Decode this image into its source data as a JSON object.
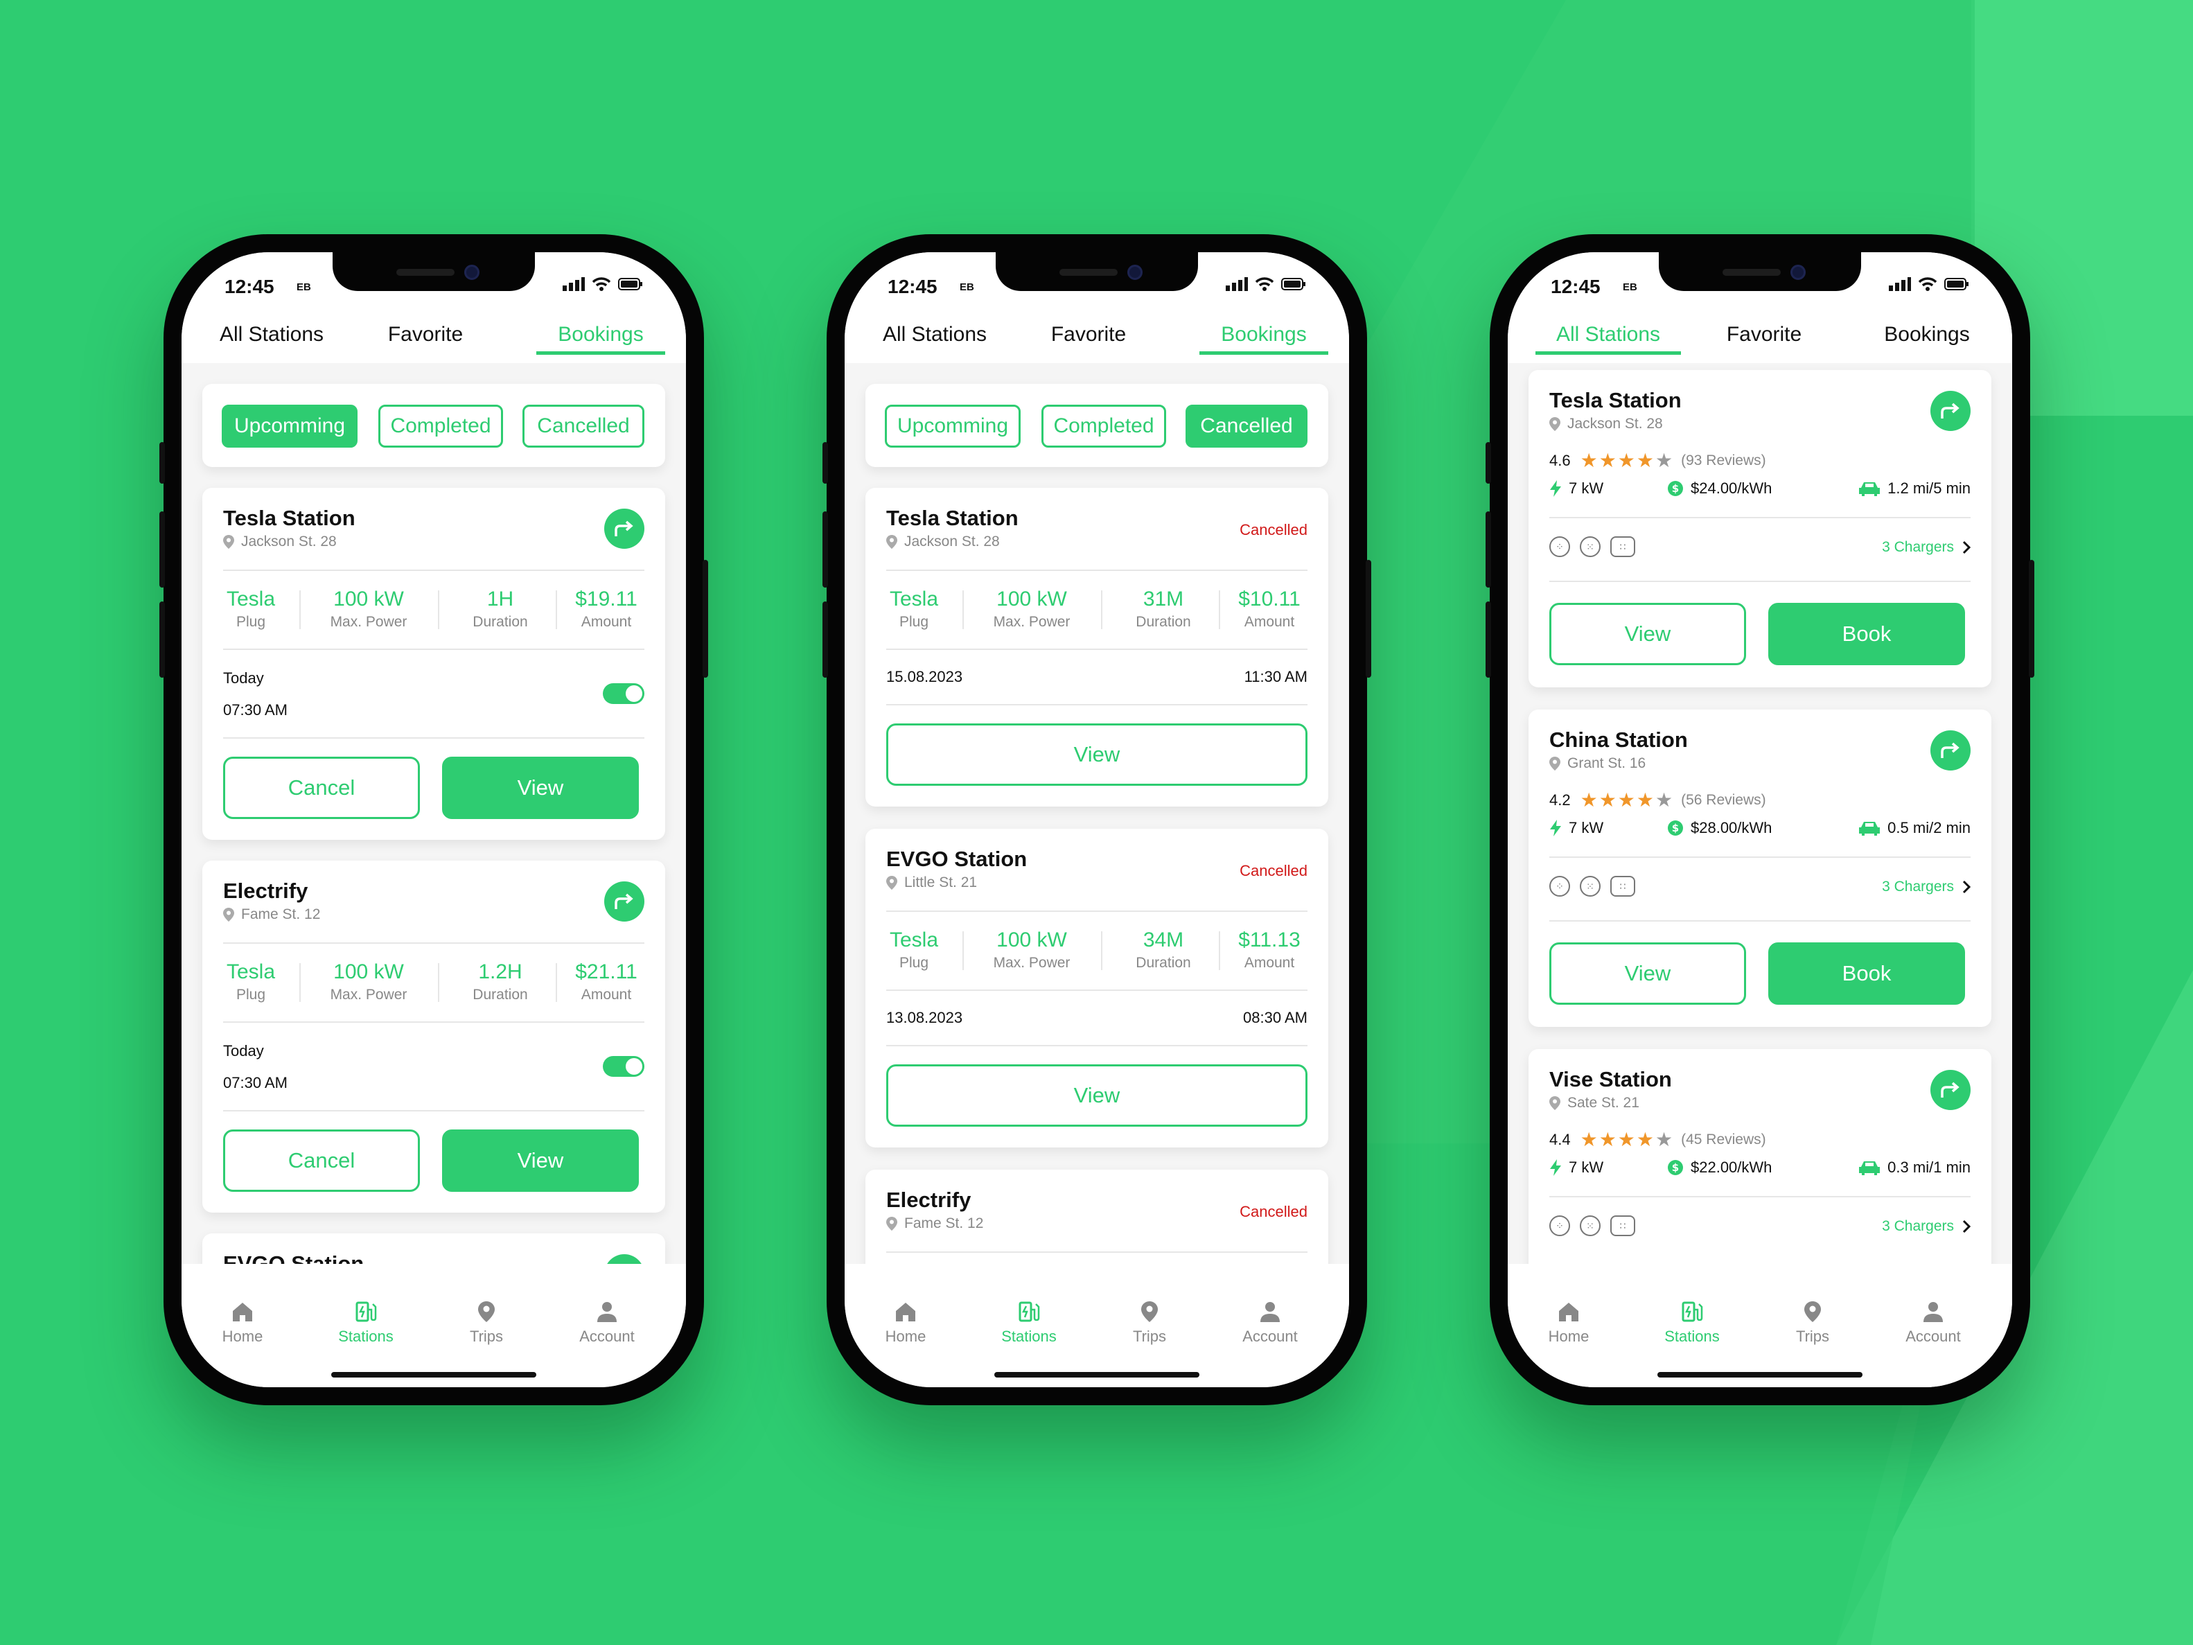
{
  "colors": {
    "accent": "#2ecc71",
    "cancelled": "#d11a1a",
    "star": "#f0962a",
    "background": "#2ecc71"
  },
  "phones": [
    {
      "status": {
        "time": "12:45",
        "carrier": "EB"
      },
      "tabs": [
        {
          "label": "All Stations"
        },
        {
          "label": "Favorite"
        },
        {
          "label": "Bookings"
        }
      ],
      "active_tab": "Bookings",
      "filters": [
        {
          "label": "Upcomming"
        },
        {
          "label": "Completed"
        },
        {
          "label": "Cancelled"
        }
      ],
      "active_filter": "Upcomming",
      "bookings": [
        {
          "name": "Tesla Station",
          "address": "Jackson St. 28",
          "icon": "route-icon",
          "stats": [
            {
              "value": "Tesla",
              "label": "Plug"
            },
            {
              "value": "100 kW",
              "label": "Max. Power"
            },
            {
              "value": "1H",
              "label": "Duration"
            },
            {
              "value": "$19.11",
              "label": "Amount"
            }
          ],
          "day": "Today",
          "time": "07:30 AM",
          "toggle_on": true,
          "cancel_label": "Cancel",
          "view_label": "View"
        },
        {
          "name": "Electrify",
          "address": "Fame St. 12",
          "icon": "route-icon",
          "stats": [
            {
              "value": "Tesla",
              "label": "Plug"
            },
            {
              "value": "100 kW",
              "label": "Max. Power"
            },
            {
              "value": "1.2H",
              "label": "Duration"
            },
            {
              "value": "$21.11",
              "label": "Amount"
            }
          ],
          "day": "Today",
          "time": "07:30 AM",
          "toggle_on": true,
          "cancel_label": "Cancel",
          "view_label": "View"
        },
        {
          "name": "EVGO Station"
        }
      ],
      "nav": [
        {
          "label": "Home"
        },
        {
          "label": "Stations"
        },
        {
          "label": "Trips"
        },
        {
          "label": "Account"
        }
      ],
      "active_nav": "Stations"
    },
    {
      "status": {
        "time": "12:45",
        "carrier": "EB"
      },
      "tabs": [
        {
          "label": "All Stations"
        },
        {
          "label": "Favorite"
        },
        {
          "label": "Bookings"
        }
      ],
      "active_tab": "Bookings",
      "filters": [
        {
          "label": "Upcomming"
        },
        {
          "label": "Completed"
        },
        {
          "label": "Cancelled"
        }
      ],
      "active_filter": "Cancelled",
      "bookings": [
        {
          "name": "Tesla Station",
          "address": "Jackson St. 28",
          "status": "Cancelled",
          "stats": [
            {
              "value": "Tesla",
              "label": "Plug"
            },
            {
              "value": "100 kW",
              "label": "Max. Power"
            },
            {
              "value": "31M",
              "label": "Duration"
            },
            {
              "value": "$10.11",
              "label": "Amount"
            }
          ],
          "date": "15.08.2023",
          "time": "11:30 AM",
          "view_label": "View"
        },
        {
          "name": "EVGO Station",
          "address": "Little St. 21",
          "status": "Cancelled",
          "stats": [
            {
              "value": "Tesla",
              "label": "Plug"
            },
            {
              "value": "100 kW",
              "label": "Max. Power"
            },
            {
              "value": "34M",
              "label": "Duration"
            },
            {
              "value": "$11.13",
              "label": "Amount"
            }
          ],
          "date": "13.08.2023",
          "time": "08:30 AM",
          "view_label": "View"
        },
        {
          "name": "Electrify",
          "address": "Fame St. 12",
          "status": "Cancelled"
        }
      ],
      "nav": [
        {
          "label": "Home"
        },
        {
          "label": "Stations"
        },
        {
          "label": "Trips"
        },
        {
          "label": "Account"
        }
      ],
      "active_nav": "Stations"
    },
    {
      "status": {
        "time": "12:45",
        "carrier": "EB"
      },
      "tabs": [
        {
          "label": "All Stations"
        },
        {
          "label": "Favorite"
        },
        {
          "label": "Bookings"
        }
      ],
      "active_tab": "All Stations",
      "stations": [
        {
          "name": "Tesla Station",
          "address": "Jackson St. 28",
          "rating": "4.6",
          "rating_value": 4.6,
          "reviews": "(93 Reviews)",
          "power": "7 kW",
          "price": "$24.00/kWh",
          "distance": "1.2 mi/5 min",
          "chargers": "3 Chargers",
          "view_label": "View",
          "book_label": "Book"
        },
        {
          "name": "China Station",
          "address": "Grant St. 16",
          "rating": "4.2",
          "rating_value": 4.2,
          "reviews": "(56 Reviews)",
          "power": "7 kW",
          "price": "$28.00/kWh",
          "distance": "0.5 mi/2 min",
          "chargers": "3 Chargers",
          "view_label": "View",
          "book_label": "Book"
        },
        {
          "name": "Vise Station",
          "address": "Sate St. 21",
          "rating": "4.4",
          "rating_value": 4.4,
          "reviews": "(45 Reviews)",
          "power": "7 kW",
          "price": "$22.00/kWh",
          "distance": "0.3 mi/1 min",
          "chargers": "3 Chargers"
        }
      ],
      "nav": [
        {
          "label": "Home"
        },
        {
          "label": "Stations"
        },
        {
          "label": "Trips"
        },
        {
          "label": "Account"
        }
      ],
      "active_nav": "Stations"
    }
  ]
}
